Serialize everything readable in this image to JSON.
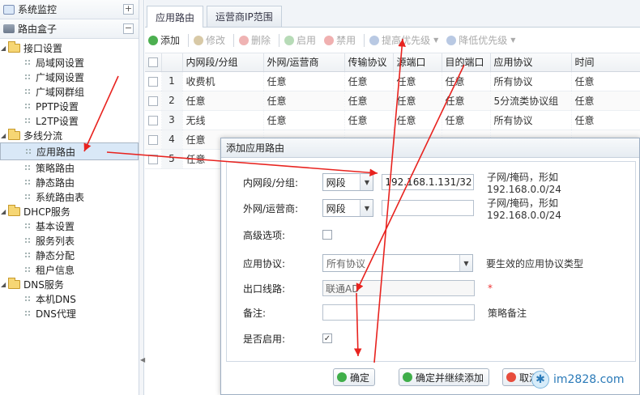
{
  "sidebar": {
    "panel1": {
      "title": "系统监控",
      "toggle": "+"
    },
    "panel2": {
      "title": "路由盒子",
      "toggle": "−"
    },
    "groups": [
      {
        "label": "接口设置",
        "items": [
          "局域网设置",
          "广域网设置",
          "广域网群组",
          "PPTP设置",
          "L2TP设置"
        ]
      },
      {
        "label": "多线分流",
        "items": [
          "应用路由",
          "策略路由",
          "静态路由",
          "系统路由表"
        ]
      },
      {
        "label": "DHCP服务",
        "items": [
          "基本设置",
          "服务列表",
          "静态分配",
          "租户信息"
        ]
      },
      {
        "label": "DNS服务",
        "items": [
          "本机DNS",
          "DNS代理"
        ]
      }
    ]
  },
  "tabs": [
    "应用路由",
    "运营商IP范围"
  ],
  "toolbar": {
    "add": "添加",
    "edit": "修改",
    "delete": "删除",
    "enable": "启用",
    "disable": "禁用",
    "raise": "提高优先级",
    "lower": "降低优先级"
  },
  "table": {
    "headers": [
      "内网段/分组",
      "外网/运营商",
      "传输协议",
      "源端口",
      "目的端口",
      "应用协议",
      "时间"
    ],
    "rows": [
      {
        "num": "1",
        "cells": [
          "收费机",
          "任意",
          "任意",
          "任意",
          "任意",
          "所有协议",
          "任意"
        ]
      },
      {
        "num": "2",
        "cells": [
          "任意",
          "任意",
          "任意",
          "任意",
          "任意",
          "5分流类协议组",
          "任意"
        ]
      },
      {
        "num": "3",
        "cells": [
          "无线",
          "任意",
          "任意",
          "任意",
          "任意",
          "所有协议",
          "任意"
        ]
      },
      {
        "num": "4",
        "cells": [
          "任意",
          "",
          "",
          "",
          "",
          "",
          ""
        ]
      },
      {
        "num": "5",
        "cells": [
          "任意",
          "",
          "",
          "",
          "",
          "",
          ""
        ]
      }
    ]
  },
  "dialog": {
    "title": "添加应用路由",
    "lan_label": "内网段/分组:",
    "lan_type": "网段",
    "lan_value": "192.168.1.131/32",
    "lan_hint": "子网/掩码，形如 192.168.0.0/24",
    "wan_label": "外网/运营商:",
    "wan_type": "网段",
    "wan_value": "",
    "wan_hint": "子网/掩码，形如 192.168.0.0/24",
    "advanced_label": "高级选项:",
    "advanced_checked": false,
    "proto_label": "应用协议:",
    "proto_value": "所有协议",
    "proto_hint": "要生效的应用协议类型",
    "line_label": "出口线路:",
    "line_value": "联通AD",
    "line_required": "*",
    "note_label": "备注:",
    "note_value": "",
    "note_hint": "策略备注",
    "enabled_label": "是否启用:",
    "enabled_checked": true,
    "check_mark": "✓",
    "ok": "确定",
    "ok_continue": "确定并继续添加",
    "cancel": "取消"
  },
  "watermark": {
    "text": "im2828.com"
  },
  "colors": {
    "annotation_arrow": "#e8231f",
    "accent": "#2a7ab8"
  }
}
